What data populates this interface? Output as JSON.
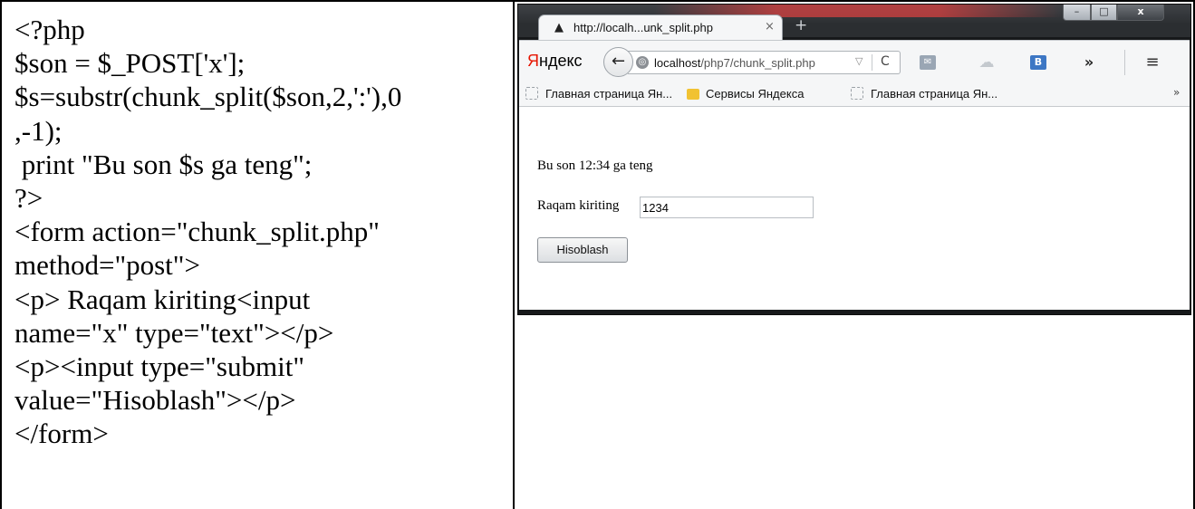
{
  "code_lines": [
    "<?php",
    "$son = $_POST['x'];",
    "$s=substr(chunk_split($son,2,':'),0",
    ",-1);",
    " print \"Bu son $s ga teng\";",
    "?>",
    "<form action=\"chunk_split.php\"",
    "method=\"post\">",
    "<p> Raqam kiriting<input",
    "name=\"x\" type=\"text\"></p>",
    "<p><input type=\"submit\"",
    "value=\"Hisoblash\"></p>",
    "</form>"
  ],
  "browser": {
    "window_controls": {
      "minimize": "–",
      "maximize": "□",
      "close": "x"
    },
    "tab": {
      "title": "http://localh...unk_split.php",
      "close": "×",
      "icon": "spy-hat-icon"
    },
    "new_tab": "+",
    "navbar": {
      "logo_first": "Я",
      "logo_rest": "ндекс",
      "back": "←",
      "url_host": "localhost",
      "url_path": "/php7/chunk_split.php",
      "url_dropdown": "▽",
      "reload": "C",
      "more": "»",
      "menu": "≡"
    },
    "bookmarks": [
      {
        "label": "Главная страница Ян...",
        "icon": "dotted-page-icon"
      },
      {
        "label": "Сервисы Яндекса",
        "icon": "folder-icon"
      },
      {
        "label": "Главная страница Ян...",
        "icon": "dotted-page-icon"
      }
    ],
    "bookmarks_overflow": "»",
    "page": {
      "result_text": "Bu son 12:34 ga teng",
      "input_label": "Raqam kiriting",
      "input_value": "1234",
      "submit_label": "Hisoblash"
    }
  }
}
